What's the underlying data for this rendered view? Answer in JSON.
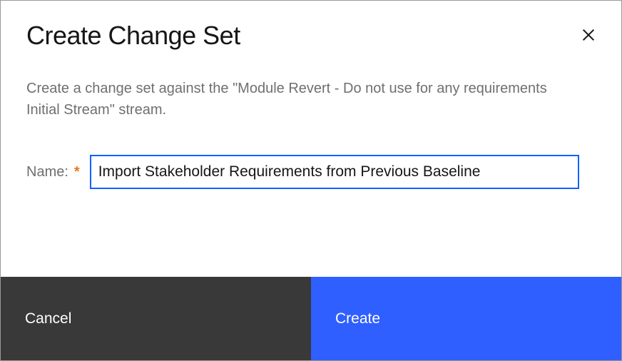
{
  "dialog": {
    "title": "Create Change Set",
    "description": "Create a change set against the \"Module Revert - Do not use for any requirements Initial Stream\" stream.",
    "name_label": "Name:",
    "required_marker": "*",
    "name_value": "Import Stakeholder Requirements from Previous Baseline",
    "cancel_label": "Cancel",
    "create_label": "Create"
  }
}
